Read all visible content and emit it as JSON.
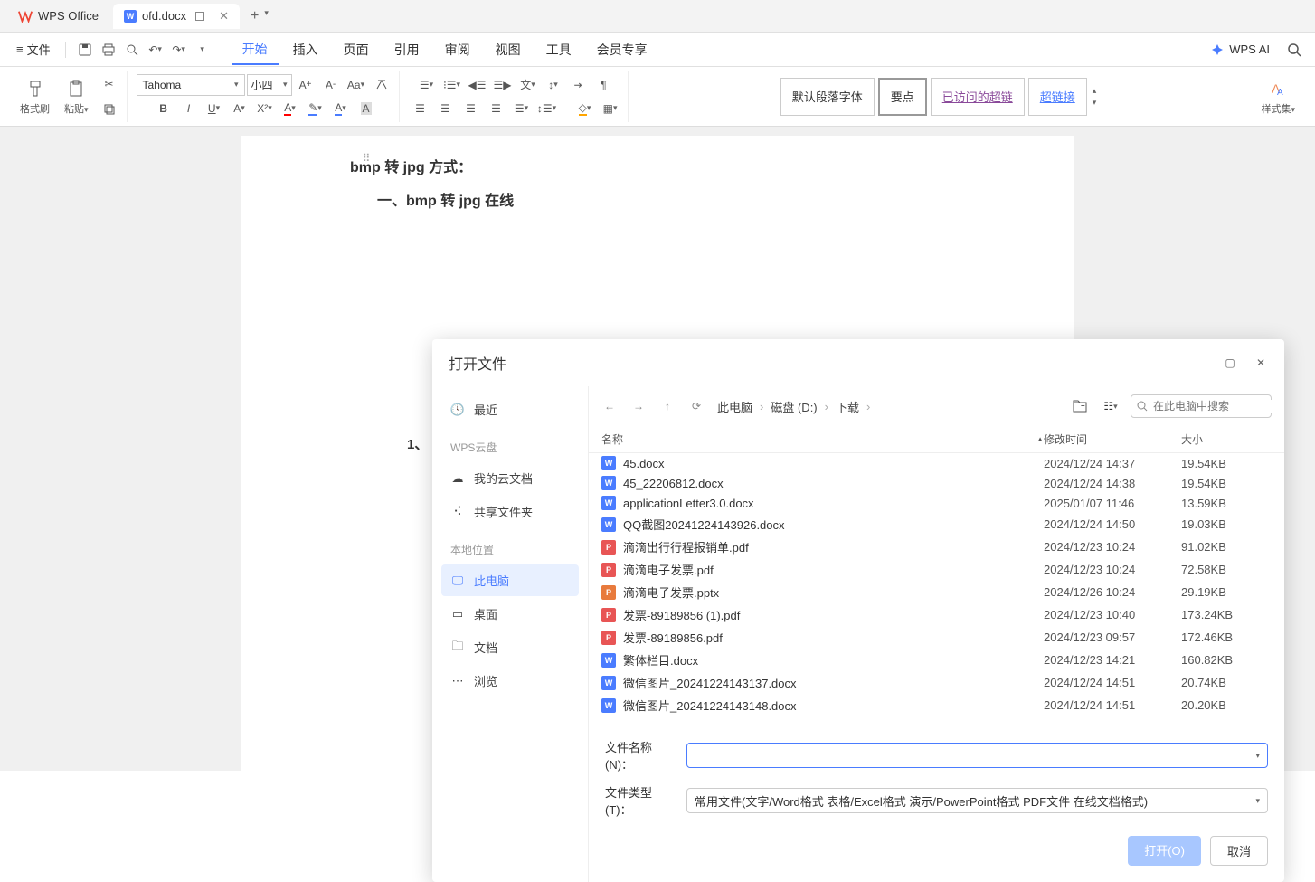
{
  "titlebar": {
    "app_name": "WPS Office",
    "doc_name": "ofd.docx"
  },
  "menubar": {
    "file_label": "文件",
    "items": [
      "开始",
      "插入",
      "页面",
      "引用",
      "审阅",
      "视图",
      "工具",
      "会员专享"
    ],
    "wps_ai": "WPS AI"
  },
  "toolbar": {
    "format_painter": "格式刷",
    "paste": "粘贴",
    "font": "Tahoma",
    "size": "小四",
    "style_default": "默认段落字体",
    "style_point": "要点",
    "style_visited": "已访问的超链",
    "style_link": "超链接",
    "style_set": "样式集"
  },
  "document": {
    "line1": "bmp 转 jpg 方式：",
    "line2": "一、bmp 转 jpg 在线",
    "num": "1、"
  },
  "dialog": {
    "title": "打开文件",
    "sidebar": {
      "recent": "最近",
      "cloud_heading": "WPS云盘",
      "my_cloud": "我的云文档",
      "shared": "共享文件夹",
      "local_heading": "本地位置",
      "this_pc": "此电脑",
      "desktop": "桌面",
      "documents": "文档",
      "browse": "浏览"
    },
    "breadcrumb": [
      "此电脑",
      "磁盘 (D:)",
      "下载"
    ],
    "search_placeholder": "在此电脑中搜索",
    "columns": {
      "name": "名称",
      "date": "修改时间",
      "size": "大小"
    },
    "files": [
      {
        "icon": "w",
        "name": "45.docx",
        "date": "2024/12/24 14:37",
        "size": "19.54KB"
      },
      {
        "icon": "w",
        "name": "45_22206812.docx",
        "date": "2024/12/24 14:38",
        "size": "19.54KB"
      },
      {
        "icon": "w",
        "name": "applicationLetter3.0.docx",
        "date": "2025/01/07 11:46",
        "size": "13.59KB"
      },
      {
        "icon": "w",
        "name": "QQ截图20241224143926.docx",
        "date": "2024/12/24 14:50",
        "size": "19.03KB"
      },
      {
        "icon": "p",
        "name": "滴滴出行行程报销单.pdf",
        "date": "2024/12/23 10:24",
        "size": "91.02KB"
      },
      {
        "icon": "p",
        "name": "滴滴电子发票.pdf",
        "date": "2024/12/23 10:24",
        "size": "72.58KB"
      },
      {
        "icon": "pp",
        "name": "滴滴电子发票.pptx",
        "date": "2024/12/26 10:24",
        "size": "29.19KB"
      },
      {
        "icon": "p",
        "name": "发票-89189856 (1).pdf",
        "date": "2024/12/23 10:40",
        "size": "173.24KB"
      },
      {
        "icon": "p",
        "name": "发票-89189856.pdf",
        "date": "2024/12/23 09:57",
        "size": "172.46KB"
      },
      {
        "icon": "w",
        "name": "繁体栏目.docx",
        "date": "2024/12/23 14:21",
        "size": "160.82KB"
      },
      {
        "icon": "w",
        "name": "微信图片_20241224143137.docx",
        "date": "2024/12/24 14:51",
        "size": "20.74KB"
      },
      {
        "icon": "w",
        "name": "微信图片_20241224143148.docx",
        "date": "2024/12/24 14:51",
        "size": "20.20KB"
      }
    ],
    "footer": {
      "filename_label": "文件名称(N)：",
      "filetype_label": "文件类型(T)：",
      "filetype_value": "常用文件(文字/Word格式 表格/Excel格式 演示/PowerPoint格式 PDF文件 在线文档格式)",
      "open_btn": "打开(O)",
      "cancel_btn": "取消"
    }
  }
}
